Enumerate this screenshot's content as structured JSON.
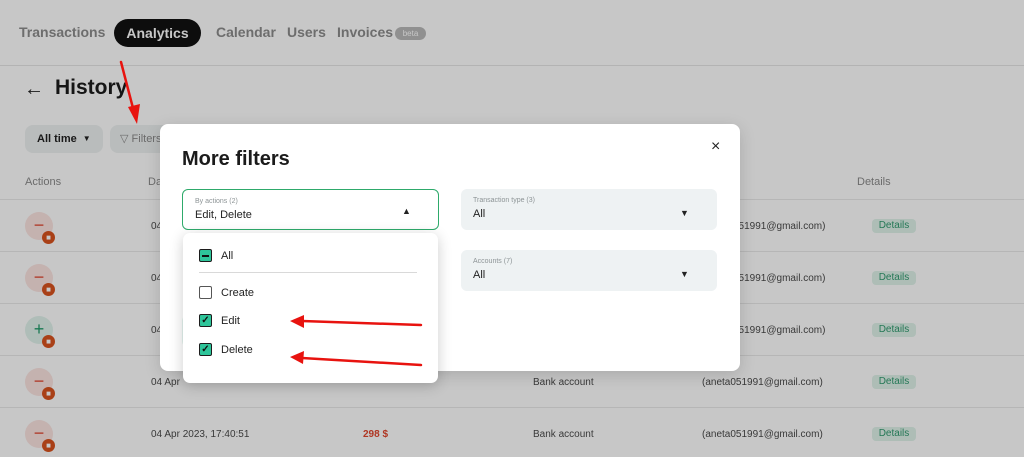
{
  "nav": {
    "items": [
      "Transactions",
      "Analytics",
      "Calendar",
      "Users",
      "Invoices"
    ],
    "active": "Analytics",
    "beta_badge": "beta"
  },
  "page": {
    "title": "History",
    "filters": {
      "time_label": "All time",
      "filters_label": "Filters"
    }
  },
  "table": {
    "headers": [
      "Actions",
      "Date",
      "Details"
    ],
    "rows": [
      {
        "action": "delete",
        "date": "04",
        "amount": "",
        "account": "",
        "user": "051991@gmail.com)",
        "details": "Details"
      },
      {
        "action": "delete",
        "date": "04",
        "amount": "",
        "account": "",
        "user": "051991@gmail.com)",
        "details": "Details"
      },
      {
        "action": "create",
        "date": "04",
        "amount": "",
        "account": "",
        "user": "051991@gmail.com)",
        "details": "Details"
      },
      {
        "action": "delete",
        "date": "04 Apr",
        "amount": "",
        "account": "Bank account",
        "user": "(aneta051991@gmail.com)",
        "details": "Details"
      },
      {
        "action": "delete",
        "date": "04 Apr 2023, 17:40:51",
        "amount": "298 $",
        "account": "Bank account",
        "user": "(aneta051991@gmail.com)",
        "details": "Details"
      }
    ]
  },
  "modal": {
    "title": "More filters",
    "close_icon": "×",
    "by_actions": {
      "label": "By actions (2)",
      "value": "Edit, Delete"
    },
    "transaction_type": {
      "label": "Transaction type (3)",
      "value": "All"
    },
    "accounts": {
      "label": "Accounts (7)",
      "value": "All"
    }
  },
  "dropdown": {
    "options": [
      {
        "label": "All",
        "state": "partial"
      },
      {
        "label": "Create",
        "state": "unchecked"
      },
      {
        "label": "Edit",
        "state": "checked"
      },
      {
        "label": "Delete",
        "state": "checked"
      }
    ]
  },
  "colors": {
    "accent_green": "#2ec59a",
    "red": "#e1452e",
    "annotation_red": "#e8130f"
  }
}
